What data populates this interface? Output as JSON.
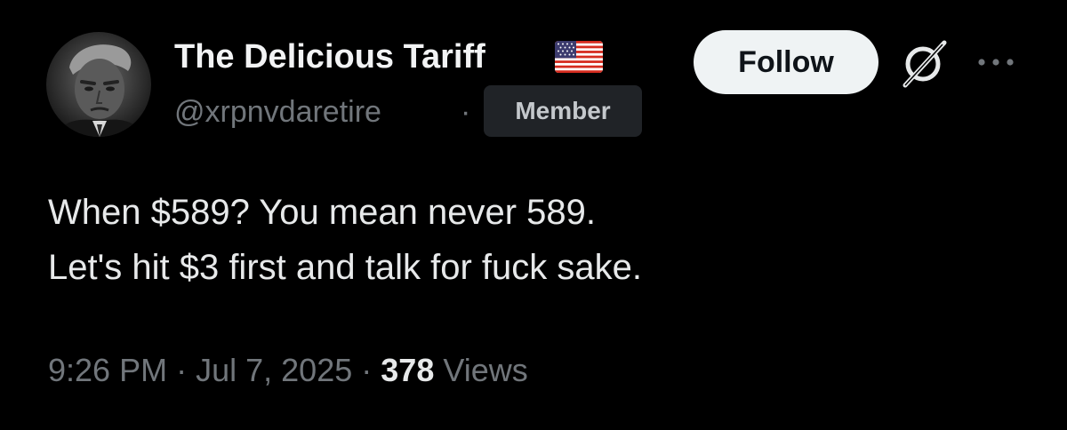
{
  "author": {
    "display_name": "The Delicious Tariff",
    "handle": "@xrpnvdaretire",
    "separator": "·",
    "badge": "Member",
    "flag_icon": "us-flag-icon",
    "avatar_icon": "avatar-photo"
  },
  "actions": {
    "follow_label": "Follow",
    "grok_icon": "grok-icon",
    "more_icon": "more-icon"
  },
  "post": {
    "lines": [
      "When $589? You mean never 589.",
      "Let's hit $3 first and talk for fuck sake."
    ]
  },
  "meta": {
    "time": "9:26 PM",
    "sep1": "·",
    "date": "Jul 7, 2025",
    "sep2": "·",
    "views_count": "378",
    "views_label": "Views"
  },
  "colors": {
    "background": "#000000",
    "primary_text": "#e7e9ea",
    "secondary_text": "#71767b",
    "follow_bg": "#eff3f4",
    "badge_bg": "#202327"
  }
}
